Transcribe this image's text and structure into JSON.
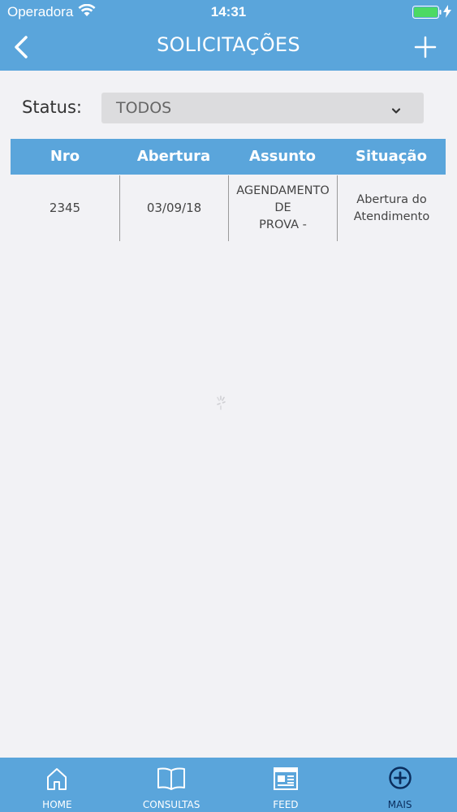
{
  "status_bar": {
    "carrier": "Operadora",
    "time": "14:31"
  },
  "navbar": {
    "title": "SOLICITAÇÕES"
  },
  "filter": {
    "label": "Status:",
    "selected": "TODOS"
  },
  "table": {
    "columns": [
      "Nro",
      "Abertura",
      "Assunto",
      "Situação"
    ],
    "rows": [
      {
        "nro": "2345",
        "abertura": "03/09/18",
        "assunto_line1": "AGENDAMENTO DE",
        "assunto_line2": "PROVA -",
        "situacao_line1": "Abertura do",
        "situacao_line2": "Atendimento"
      }
    ]
  },
  "tabbar": {
    "items": [
      {
        "label": "HOME",
        "icon": "home-icon"
      },
      {
        "label": "CONSULTAS",
        "icon": "book-icon"
      },
      {
        "label": "FEED",
        "icon": "newspaper-icon"
      },
      {
        "label": "MAIS",
        "icon": "plus-circle-icon",
        "active": true
      }
    ]
  },
  "colors": {
    "primary": "#5aa5db",
    "active_tab": "#0b2e5e",
    "background": "#f2f2f5"
  }
}
